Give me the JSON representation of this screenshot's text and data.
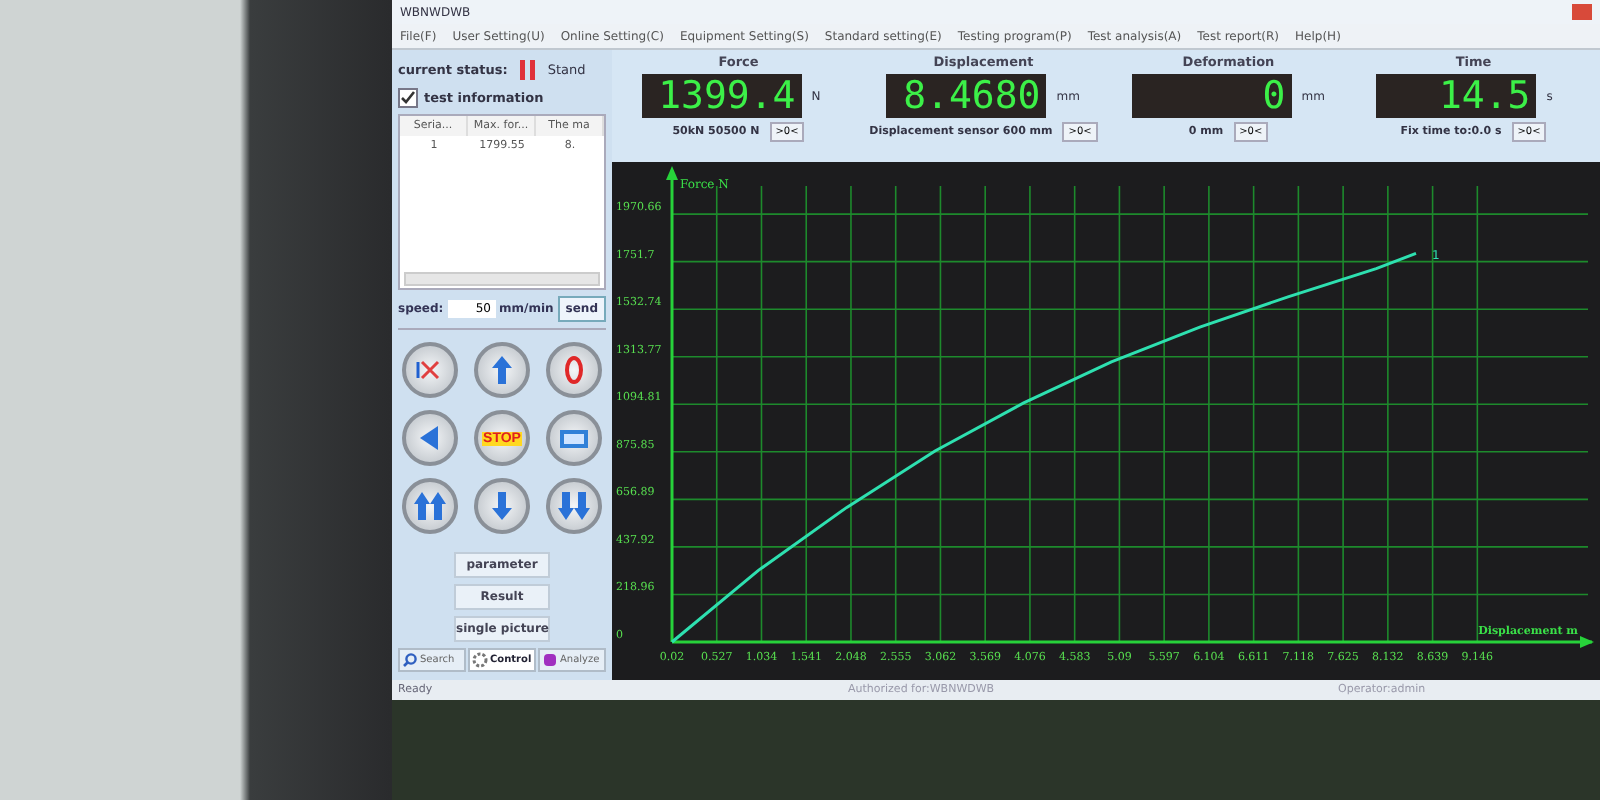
{
  "window": {
    "title": "WBNWDWB"
  },
  "menu": [
    "File(F)",
    "User Setting(U)",
    "Online Setting(C)",
    "Equipment Setting(S)",
    "Standard setting(E)",
    "Testing program(P)",
    "Test analysis(A)",
    "Test report(R)",
    "Help(H)"
  ],
  "status": {
    "label": "current status:",
    "value": "Stand"
  },
  "test_info": {
    "label": "test information",
    "checked": true,
    "columns": [
      "Seria...",
      "Max. for...",
      "The ma"
    ],
    "rows": [
      [
        "1",
        "1799.55",
        "8."
      ]
    ]
  },
  "speed": {
    "label": "speed:",
    "value": "50",
    "unit": "mm/min",
    "button": "send"
  },
  "controls": [
    {
      "kind": "cancel"
    },
    {
      "kind": "up"
    },
    {
      "kind": "zero"
    },
    {
      "kind": "left"
    },
    {
      "kind": "stop",
      "label": "STOP"
    },
    {
      "kind": "display"
    },
    {
      "kind": "fast-up"
    },
    {
      "kind": "down"
    },
    {
      "kind": "fast-down"
    }
  ],
  "buttons": [
    "parameter",
    "Result",
    "single picture"
  ],
  "tabs": [
    {
      "label": "Search",
      "kind": "search",
      "selected": false
    },
    {
      "label": "Control",
      "kind": "control",
      "selected": true
    },
    {
      "label": "Analyze",
      "kind": "analyze",
      "selected": false
    }
  ],
  "readouts": [
    {
      "title": "Force",
      "value": "1399.4",
      "unit": "N",
      "sub": "50kN 50500 N",
      "zero": ">0<"
    },
    {
      "title": "Displacement",
      "value": "8.4680",
      "unit": "mm",
      "sub": "Displacement sensor 600 mm",
      "zero": ">0<"
    },
    {
      "title": "Deformation",
      "value": "0",
      "unit": "mm",
      "sub": "0 mm",
      "zero": ">0<"
    },
    {
      "title": "Time",
      "value": "14.5",
      "unit": "s",
      "sub": "Fix time to:0.0 s",
      "zero": ">0<"
    }
  ],
  "chart": {
    "chart_data": {
      "type": "line",
      "xlabel": "Displacement m",
      "ylabel": "Force N",
      "x": [
        0.02,
        1,
        2,
        3,
        4,
        5,
        6,
        7,
        8,
        8.45
      ],
      "series": [
        {
          "name": "1",
          "color": "#2ee0b0",
          "values": [
            0,
            330,
            620,
            880,
            1100,
            1290,
            1450,
            1590,
            1720,
            1790
          ]
        }
      ],
      "xlim": [
        0.02,
        10.4
      ],
      "ylim": [
        0,
        2100
      ],
      "grid": true,
      "xticks": [
        0.02,
        0.527,
        1.034,
        1.541,
        2.048,
        2.555,
        3.062,
        3.569,
        4.076,
        4.583,
        5.09,
        5.597,
        6.104,
        6.611,
        7.118,
        7.625,
        8.132,
        8.639,
        9.146
      ],
      "yticks": [
        0,
        218.96,
        437.92,
        656.89,
        875.85,
        1094.81,
        1313.77,
        1532.74,
        1751.7,
        1970.66
      ]
    }
  },
  "status_bar": [
    "Ready",
    "Authorized for:WBNWDWB",
    "Operator:admin"
  ]
}
